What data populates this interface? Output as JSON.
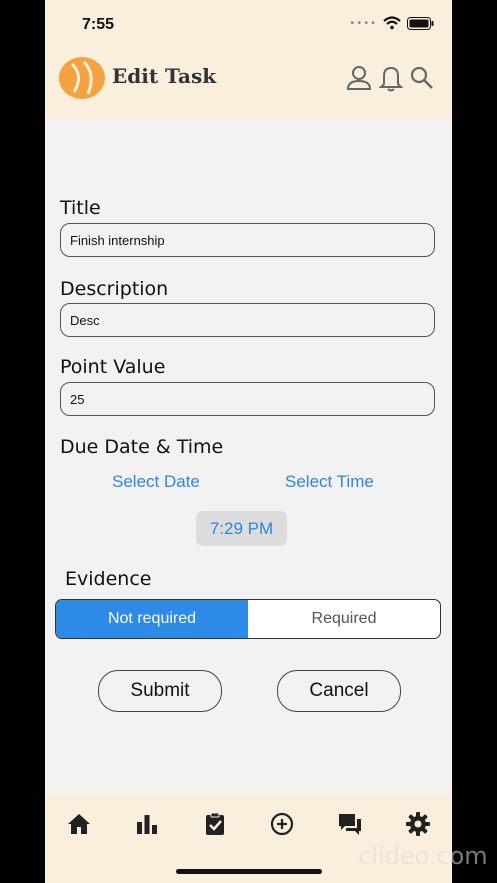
{
  "status": {
    "time": "7:55"
  },
  "header": {
    "title": "Edit Task"
  },
  "form": {
    "title_label": "Title",
    "title_value": "Finish internship",
    "description_label": "Description",
    "description_value": "Desc",
    "points_label": "Point Value",
    "points_value": "25",
    "due_label": "Due Date & Time",
    "select_date": "Select Date",
    "select_time": "Select Time",
    "selected_time": "7:29 PM",
    "evidence_label": "Evidence",
    "evidence_options": [
      "Not required",
      "Required"
    ],
    "evidence_selected": "Not required",
    "submit_label": "Submit",
    "cancel_label": "Cancel"
  },
  "tabs": [
    "home-icon",
    "chart-icon",
    "clipboard-check-icon",
    "add-circle-icon",
    "chat-icon",
    "gear-icon"
  ],
  "watermark": "clideo.com",
  "colors": {
    "accent": "#2d8ae6",
    "header_bg": "#faeedd",
    "logo": "#f5a340"
  }
}
